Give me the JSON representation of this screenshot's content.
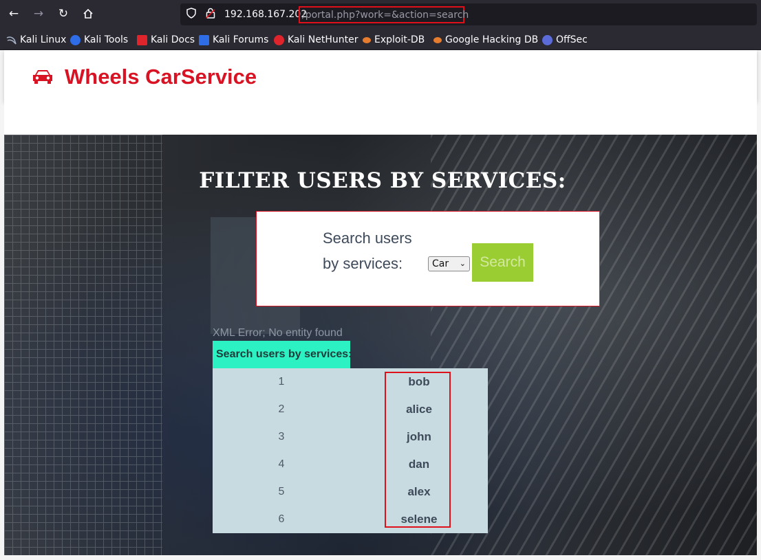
{
  "browser": {
    "url_host": "192.168.167.202",
    "url_path": "/portal.php?work=&action=search",
    "bookmarks": [
      {
        "label": "Kali Linux",
        "icon": "kali-dragon-icon",
        "color": "#367bf0"
      },
      {
        "label": "Kali Tools",
        "icon": "kali-tools-icon",
        "color": "#2f6de6"
      },
      {
        "label": "Kali Docs",
        "icon": "kali-docs-icon",
        "color": "#e0242c"
      },
      {
        "label": "Kali Forums",
        "icon": "kali-forums-icon",
        "color": "#2f6de6"
      },
      {
        "label": "Kali NetHunter",
        "icon": "kali-nethunter-icon",
        "color": "#e0242c"
      },
      {
        "label": "Exploit-DB",
        "icon": "exploit-db-icon",
        "color": "#e57c2e"
      },
      {
        "label": "Google Hacking DB",
        "icon": "ghdb-icon",
        "color": "#e57c2e"
      },
      {
        "label": "OffSec",
        "icon": "offsec-icon",
        "color": "#5b6bd8"
      }
    ]
  },
  "site": {
    "brand": "Wheels CarService",
    "brand_color": "#d81324"
  },
  "hero": {
    "title": "FILTER USERS BY SERVICES:"
  },
  "search": {
    "label": "Search users by services:",
    "selected_service": "Car",
    "button_label": "Search",
    "button_color": "#9acd32"
  },
  "results": {
    "error": "XML Error; No entity found",
    "header": "Search users by services:",
    "rows": [
      {
        "num": "1",
        "name": "bob"
      },
      {
        "num": "2",
        "name": "alice"
      },
      {
        "num": "3",
        "name": "john"
      },
      {
        "num": "4",
        "name": "dan"
      },
      {
        "num": "5",
        "name": "alex"
      },
      {
        "num": "6",
        "name": "selene"
      }
    ]
  }
}
